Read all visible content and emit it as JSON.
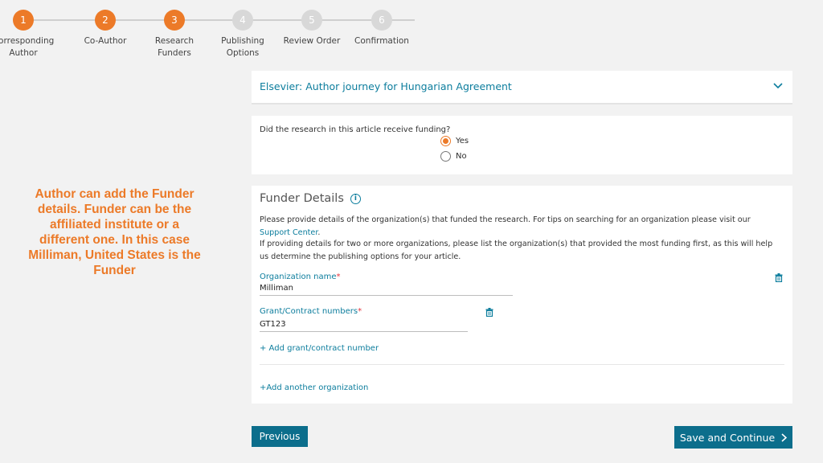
{
  "stepper": {
    "steps": [
      {
        "number": "1",
        "label_line1": "Corresponding",
        "label_line2": "Author",
        "state": "complete"
      },
      {
        "number": "2",
        "label_line1": "Co-Author",
        "label_line2": "",
        "state": "complete"
      },
      {
        "number": "3",
        "label_line1": "Research",
        "label_line2": "Funders",
        "state": "current"
      },
      {
        "number": "4",
        "label_line1": "Publishing",
        "label_line2": "Options",
        "state": "upcoming"
      },
      {
        "number": "5",
        "label_line1": "Review Order",
        "label_line2": "",
        "state": "upcoming"
      },
      {
        "number": "6",
        "label_line1": "Confirmation",
        "label_line2": "",
        "state": "upcoming"
      }
    ],
    "active_color": "#ec7a28",
    "inactive_color": "#d8d8d8"
  },
  "note": {
    "text": "Author can add the Funder details. Funder can be the affiliated institute or a different one. In this case Milliman, United States is the Funder",
    "color": "#ec7a28"
  },
  "journey": {
    "title": "Elsevier: Author journey for Hungarian Agreement",
    "icon": "chevron-down-icon"
  },
  "funding": {
    "question": "Did the research in this article receive funding?",
    "options": [
      {
        "label": "Yes",
        "checked": true
      },
      {
        "label": "No",
        "checked": false
      }
    ]
  },
  "funder": {
    "title": "Funder Details",
    "para1_prefix": "Please provide details of the organization(s) that funded the research. For tips on searching for an organization please visit our ",
    "para1_link": "Support Center",
    "para1_suffix": ".",
    "para2": "If providing details for two or more organizations, please list the organization(s) that provided the most funding first, as this will help us determine the publishing options for your article.",
    "org_label": "Organization name",
    "org_value": "Milliman",
    "grant_label": "Grant/Contract numbers",
    "grant_value": "GT123",
    "required_mark": "*",
    "add_grant": "+ Add grant/contract number",
    "add_org": "+Add another organization"
  },
  "buttons": {
    "previous": "Previous",
    "save_continue": "Save and Continue"
  },
  "colors": {
    "link": "#0c7d9d",
    "button": "#0c6e8c",
    "required": "#e5333b"
  }
}
